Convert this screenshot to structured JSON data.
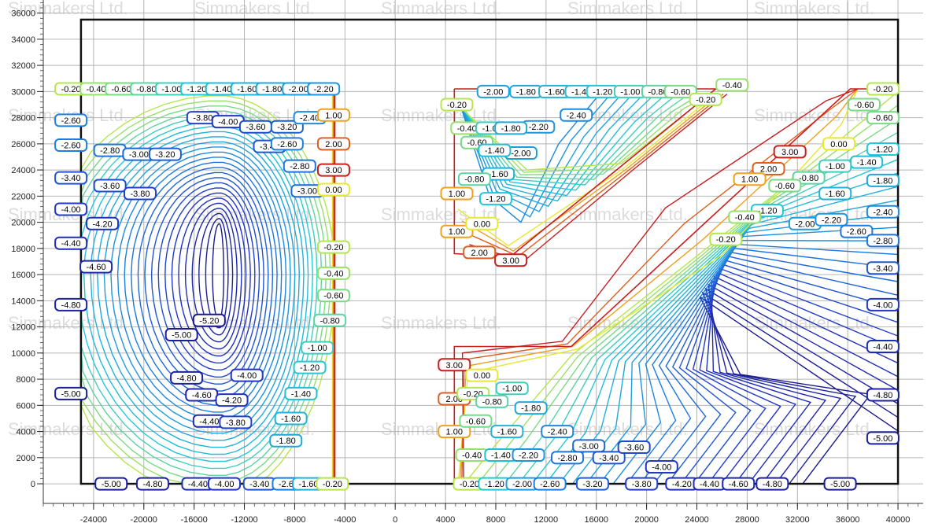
{
  "chart_data": {
    "type": "contour",
    "watermark": "Simmakers Ltd.",
    "xlim": [
      -28000,
      42000
    ],
    "ylim": [
      -1500,
      37000
    ],
    "x_ticks": [
      -24000,
      -20000,
      -16000,
      -12000,
      -8000,
      -4000,
      0,
      4000,
      8000,
      12000,
      16000,
      20000,
      24000,
      28000,
      32000,
      36000,
      40000
    ],
    "y_ticks": [
      0,
      2000,
      4000,
      6000,
      8000,
      10000,
      12000,
      14000,
      16000,
      18000,
      20000,
      22000,
      24000,
      26000,
      28000,
      30000,
      32000,
      34000,
      36000
    ],
    "x_tick_labels": [
      "-24000",
      "-20000",
      "-16000",
      "-12000",
      "-8000",
      "-4000",
      "0",
      "4000",
      "8000",
      "12000",
      "16000",
      "20000",
      "24000",
      "28000",
      "32000",
      "36000",
      "40000"
    ],
    "y_tick_labels": [
      "0",
      "2000",
      "4000",
      "6000",
      "8000",
      "10000",
      "12000",
      "14000",
      "16000",
      "18000",
      "20000",
      "22000",
      "24000",
      "26000",
      "28000",
      "30000",
      "32000",
      "34000",
      "36000"
    ],
    "grid": true,
    "domain_box": {
      "x": [
        -25000,
        40000
      ],
      "y": [
        0,
        35500
      ]
    },
    "color_scale": [
      {
        "value": -5.2,
        "color": "#1a1a8c"
      },
      {
        "value": -4.0,
        "color": "#2236c8"
      },
      {
        "value": -2.6,
        "color": "#1c7ee0"
      },
      {
        "value": -1.2,
        "color": "#22c8d8"
      },
      {
        "value": -0.2,
        "color": "#b4e64e"
      },
      {
        "value": 0.0,
        "color": "#e8e832"
      },
      {
        "value": 1.0,
        "color": "#f0a020"
      },
      {
        "value": 3.0,
        "color": "#c81e1e"
      }
    ],
    "contour_labels": [
      {
        "text": "-0.20",
        "x": -25800,
        "y": 30200,
        "v": -0.2
      },
      {
        "text": "-0.40",
        "x": -23800,
        "y": 30200,
        "v": -0.4
      },
      {
        "text": "-0.60",
        "x": -21800,
        "y": 30200,
        "v": -0.6
      },
      {
        "text": "-0.80",
        "x": -19800,
        "y": 30200,
        "v": -0.8
      },
      {
        "text": "-1.00",
        "x": -17800,
        "y": 30200,
        "v": -1.0
      },
      {
        "text": "-1.20",
        "x": -15800,
        "y": 30200,
        "v": -1.2
      },
      {
        "text": "-1.40",
        "x": -13800,
        "y": 30200,
        "v": -1.4
      },
      {
        "text": "-1.60",
        "x": -11800,
        "y": 30200,
        "v": -1.6
      },
      {
        "text": "-1.80",
        "x": -9800,
        "y": 30200,
        "v": -1.8
      },
      {
        "text": "-2.00",
        "x": -7700,
        "y": 30200,
        "v": -2.0
      },
      {
        "text": "-2.20",
        "x": -5700,
        "y": 30200,
        "v": -2.2
      },
      {
        "text": "-2.60",
        "x": -25800,
        "y": 27800,
        "v": -2.6
      },
      {
        "text": "-2.60",
        "x": -25800,
        "y": 25900,
        "v": -2.6
      },
      {
        "text": "-2.80",
        "x": -22700,
        "y": 25500,
        "v": -2.8
      },
      {
        "text": "-3.00",
        "x": -20400,
        "y": 25200,
        "v": -3.0
      },
      {
        "text": "-3.20",
        "x": -18300,
        "y": 25200,
        "v": -3.2
      },
      {
        "text": "-3.40",
        "x": -25800,
        "y": 23400,
        "v": -3.4
      },
      {
        "text": "-3.60",
        "x": -22700,
        "y": 22800,
        "v": -3.6
      },
      {
        "text": "-3.80",
        "x": -20300,
        "y": 22200,
        "v": -3.8
      },
      {
        "text": "-4.00",
        "x": -25800,
        "y": 21000,
        "v": -4.0
      },
      {
        "text": "-4.20",
        "x": -23300,
        "y": 19900,
        "v": -4.2
      },
      {
        "text": "-4.40",
        "x": -25800,
        "y": 18400,
        "v": -4.4
      },
      {
        "text": "-4.60",
        "x": -23800,
        "y": 16600,
        "v": -4.6
      },
      {
        "text": "-4.80",
        "x": -25800,
        "y": 13700,
        "v": -4.8
      },
      {
        "text": "-5.00",
        "x": -25800,
        "y": 6900,
        "v": -5.0
      },
      {
        "text": "-3.80",
        "x": -15300,
        "y": 28000,
        "v": -3.8
      },
      {
        "text": "-4.00",
        "x": -13300,
        "y": 27700,
        "v": -4.0
      },
      {
        "text": "-3.60",
        "x": -11100,
        "y": 27300,
        "v": -3.6
      },
      {
        "text": "-3.20",
        "x": -8600,
        "y": 27300,
        "v": -3.2
      },
      {
        "text": "-2.40",
        "x": -6800,
        "y": 28000,
        "v": -2.4
      },
      {
        "text": "-3.40",
        "x": -10000,
        "y": 25800,
        "v": -3.4
      },
      {
        "text": "-2.60",
        "x": -8600,
        "y": 26000,
        "v": -2.6
      },
      {
        "text": "-2.80",
        "x": -7600,
        "y": 24300,
        "v": -2.8
      },
      {
        "text": "-3.00",
        "x": -7000,
        "y": 22400,
        "v": -3.0
      },
      {
        "text": "1.00",
        "x": -4900,
        "y": 28200,
        "v": 1.0
      },
      {
        "text": "2.00",
        "x": -4900,
        "y": 26000,
        "v": 2.0
      },
      {
        "text": "3.00",
        "x": -4900,
        "y": 24000,
        "v": 3.0
      },
      {
        "text": "0.00",
        "x": -4900,
        "y": 22500,
        "v": 0.0
      },
      {
        "text": "-0.20",
        "x": -4900,
        "y": 18100,
        "v": -0.2
      },
      {
        "text": "-0.40",
        "x": -4900,
        "y": 16100,
        "v": -0.4
      },
      {
        "text": "-0.60",
        "x": -4900,
        "y": 14400,
        "v": -0.6
      },
      {
        "text": "-0.80",
        "x": -5200,
        "y": 12500,
        "v": -0.8
      },
      {
        "text": "-1.00",
        "x": -6200,
        "y": 10400,
        "v": -1.0
      },
      {
        "text": "-1.20",
        "x": -6800,
        "y": 8900,
        "v": -1.2
      },
      {
        "text": "-1.40",
        "x": -7500,
        "y": 6900,
        "v": -1.4
      },
      {
        "text": "-1.60",
        "x": -8300,
        "y": 5000,
        "v": -1.6
      },
      {
        "text": "-1.80",
        "x": -8700,
        "y": 3300,
        "v": -1.8
      },
      {
        "text": "-5.20",
        "x": -14800,
        "y": 12500,
        "v": -5.2
      },
      {
        "text": "-5.00",
        "x": -17000,
        "y": 11400,
        "v": -5.0
      },
      {
        "text": "-4.80",
        "x": -16600,
        "y": 8100,
        "v": -4.8
      },
      {
        "text": "-4.60",
        "x": -15400,
        "y": 6800,
        "v": -4.6
      },
      {
        "text": "-4.40",
        "x": -14800,
        "y": 4800,
        "v": -4.4
      },
      {
        "text": "-4.20",
        "x": -13000,
        "y": 6400,
        "v": -4.2
      },
      {
        "text": "-4.00",
        "x": -11800,
        "y": 8300,
        "v": -4.0
      },
      {
        "text": "-3.80",
        "x": -12700,
        "y": 4700,
        "v": -3.8
      },
      {
        "text": "-5.00",
        "x": -22600,
        "y": 0,
        "v": -5.0
      },
      {
        "text": "-4.80",
        "x": -19300,
        "y": 0,
        "v": -4.8
      },
      {
        "text": "-4.40",
        "x": -15700,
        "y": 0,
        "v": -4.4
      },
      {
        "text": "-4.00",
        "x": -13600,
        "y": 0,
        "v": -4.0
      },
      {
        "text": "-3.40",
        "x": -10800,
        "y": 0,
        "v": -3.4
      },
      {
        "text": "-2.60",
        "x": -8500,
        "y": 0,
        "v": -2.6
      },
      {
        "text": "-1.60",
        "x": -6900,
        "y": 0,
        "v": -1.6
      },
      {
        "text": "-0.20",
        "x": -5000,
        "y": 0,
        "v": -0.2
      },
      {
        "text": "-2.00",
        "x": 7800,
        "y": 30000,
        "v": -2.0
      },
      {
        "text": "-1.80",
        "x": 10400,
        "y": 30000,
        "v": -1.8
      },
      {
        "text": "-1.60",
        "x": 12700,
        "y": 30000,
        "v": -1.6
      },
      {
        "text": "-1.40",
        "x": 14800,
        "y": 30000,
        "v": -1.4
      },
      {
        "text": "-1.20",
        "x": 16500,
        "y": 30000,
        "v": -1.2
      },
      {
        "text": "-1.00",
        "x": 18700,
        "y": 30000,
        "v": -1.0
      },
      {
        "text": "-0.80",
        "x": 20900,
        "y": 30000,
        "v": -0.8
      },
      {
        "text": "-0.60",
        "x": 22700,
        "y": 30000,
        "v": -0.6
      },
      {
        "text": "-0.40",
        "x": 26800,
        "y": 30500,
        "v": -0.4
      },
      {
        "text": "-0.20",
        "x": 24700,
        "y": 29400,
        "v": -0.2
      },
      {
        "text": "-2.40",
        "x": 14400,
        "y": 28200,
        "v": -2.4
      },
      {
        "text": "-2.20",
        "x": 11400,
        "y": 27300,
        "v": -2.2
      },
      {
        "text": "-0.20",
        "x": 4900,
        "y": 29000,
        "v": -0.2
      },
      {
        "text": "-0.40",
        "x": 5700,
        "y": 27200,
        "v": -0.4
      },
      {
        "text": "-0.60",
        "x": 6500,
        "y": 26100,
        "v": -0.6
      },
      {
        "text": "-1.00",
        "x": 7700,
        "y": 27200,
        "v": -1.0
      },
      {
        "text": "-1.80",
        "x": 9200,
        "y": 27200,
        "v": -1.8
      },
      {
        "text": "-2.00",
        "x": 10000,
        "y": 25300,
        "v": -2.0
      },
      {
        "text": "-1.40",
        "x": 7900,
        "y": 25500,
        "v": -1.4
      },
      {
        "text": "-1.60",
        "x": 8200,
        "y": 23700,
        "v": -1.6
      },
      {
        "text": "-0.80",
        "x": 6300,
        "y": 23300,
        "v": -0.8
      },
      {
        "text": "-1.20",
        "x": 8000,
        "y": 21800,
        "v": -1.2
      },
      {
        "text": "1.00",
        "x": 4900,
        "y": 22200,
        "v": 1.0
      },
      {
        "text": "1.00",
        "x": 4900,
        "y": 19300,
        "v": 1.0
      },
      {
        "text": "0.00",
        "x": 6900,
        "y": 19900,
        "v": 0.0
      },
      {
        "text": "2.00",
        "x": 6700,
        "y": 17700,
        "v": 2.0
      },
      {
        "text": "3.00",
        "x": 9200,
        "y": 17100,
        "v": 3.0
      },
      {
        "text": "-0.20",
        "x": 38800,
        "y": 30200,
        "v": -0.2
      },
      {
        "text": "-0.60",
        "x": 37300,
        "y": 29000,
        "v": -0.6
      },
      {
        "text": "-0.60",
        "x": 38800,
        "y": 28000,
        "v": -0.6
      },
      {
        "text": "-1.20",
        "x": 38800,
        "y": 25600,
        "v": -1.2
      },
      {
        "text": "-1.40",
        "x": 37500,
        "y": 24600,
        "v": -1.4
      },
      {
        "text": "-1.80",
        "x": 38800,
        "y": 23200,
        "v": -1.8
      },
      {
        "text": "0.00",
        "x": 35300,
        "y": 26000,
        "v": 0.0
      },
      {
        "text": "-1.00",
        "x": 35000,
        "y": 24300,
        "v": -1.0
      },
      {
        "text": "-0.80",
        "x": 32900,
        "y": 23400,
        "v": -0.8
      },
      {
        "text": "-0.60",
        "x": 31000,
        "y": 22800,
        "v": -0.6
      },
      {
        "text": "3.00",
        "x": 31400,
        "y": 25400,
        "v": 3.0
      },
      {
        "text": "2.00",
        "x": 29700,
        "y": 24100,
        "v": 2.0
      },
      {
        "text": "1.00",
        "x": 28200,
        "y": 23300,
        "v": 1.0
      },
      {
        "text": "-1.60",
        "x": 35000,
        "y": 22200,
        "v": -1.6
      },
      {
        "text": "-1.20",
        "x": 29600,
        "y": 20900,
        "v": -1.2
      },
      {
        "text": "-0.40",
        "x": 27800,
        "y": 20400,
        "v": -0.4
      },
      {
        "text": "-0.20",
        "x": 26300,
        "y": 18700,
        "v": -0.2
      },
      {
        "text": "-2.00",
        "x": 32600,
        "y": 19900,
        "v": -2.0
      },
      {
        "text": "-2.20",
        "x": 34700,
        "y": 20200,
        "v": -2.2
      },
      {
        "text": "-2.40",
        "x": 38800,
        "y": 20800,
        "v": -2.4
      },
      {
        "text": "-2.60",
        "x": 36700,
        "y": 19300,
        "v": -2.6
      },
      {
        "text": "-2.80",
        "x": 38800,
        "y": 18600,
        "v": -2.8
      },
      {
        "text": "-3.40",
        "x": 38800,
        "y": 16500,
        "v": -3.4
      },
      {
        "text": "-4.00",
        "x": 38800,
        "y": 13700,
        "v": -4.0
      },
      {
        "text": "-4.40",
        "x": 38800,
        "y": 10500,
        "v": -4.4
      },
      {
        "text": "-4.80",
        "x": 38800,
        "y": 6800,
        "v": -4.8
      },
      {
        "text": "-5.00",
        "x": 38800,
        "y": 3500,
        "v": -5.0
      },
      {
        "text": "3.00",
        "x": 4700,
        "y": 9100,
        "v": 3.0
      },
      {
        "text": "2.00",
        "x": 4700,
        "y": 6500,
        "v": 2.0
      },
      {
        "text": "1.00",
        "x": 4700,
        "y": 4000,
        "v": 1.0
      },
      {
        "text": "0.00",
        "x": 6900,
        "y": 8300,
        "v": 0.0
      },
      {
        "text": "-0.20",
        "x": 6200,
        "y": 6900,
        "v": -0.2
      },
      {
        "text": "-0.60",
        "x": 6400,
        "y": 4800,
        "v": -0.6
      },
      {
        "text": "-0.80",
        "x": 7700,
        "y": 6300,
        "v": -0.8
      },
      {
        "text": "-1.00",
        "x": 9300,
        "y": 7300,
        "v": -1.0
      },
      {
        "text": "-1.60",
        "x": 8900,
        "y": 4000,
        "v": -1.6
      },
      {
        "text": "-1.80",
        "x": 10800,
        "y": 5800,
        "v": -1.8
      },
      {
        "text": "-2.40",
        "x": 12900,
        "y": 4000,
        "v": -2.4
      },
      {
        "text": "-0.40",
        "x": 6100,
        "y": 2200,
        "v": -0.4
      },
      {
        "text": "-1.40",
        "x": 8400,
        "y": 2200,
        "v": -1.4
      },
      {
        "text": "-2.20",
        "x": 10600,
        "y": 2200,
        "v": -2.2
      },
      {
        "text": "-2.80",
        "x": 13700,
        "y": 2000,
        "v": -2.8
      },
      {
        "text": "-3.00",
        "x": 15400,
        "y": 2900,
        "v": -3.0
      },
      {
        "text": "-3.40",
        "x": 17000,
        "y": 2000,
        "v": -3.4
      },
      {
        "text": "-3.60",
        "x": 19000,
        "y": 2800,
        "v": -3.6
      },
      {
        "text": "-4.00",
        "x": 21200,
        "y": 1300,
        "v": -4.0
      },
      {
        "text": "-0.20",
        "x": 5900,
        "y": 0,
        "v": -0.2
      },
      {
        "text": "-1.20",
        "x": 7900,
        "y": 0,
        "v": -1.2
      },
      {
        "text": "-2.00",
        "x": 10100,
        "y": 0,
        "v": -2.0
      },
      {
        "text": "-2.60",
        "x": 12300,
        "y": 0,
        "v": -2.6
      },
      {
        "text": "-3.20",
        "x": 15700,
        "y": 0,
        "v": -3.2
      },
      {
        "text": "-3.80",
        "x": 19600,
        "y": 0,
        "v": -3.8
      },
      {
        "text": "-4.20",
        "x": 22800,
        "y": 0,
        "v": -4.2
      },
      {
        "text": "-4.40",
        "x": 25000,
        "y": 0,
        "v": -4.4
      },
      {
        "text": "-4.60",
        "x": 27300,
        "y": 0,
        "v": -4.6
      },
      {
        "text": "-4.80",
        "x": 30000,
        "y": 0,
        "v": -4.8
      },
      {
        "text": "-5.00",
        "x": 35400,
        "y": 0,
        "v": -5.0
      }
    ]
  }
}
